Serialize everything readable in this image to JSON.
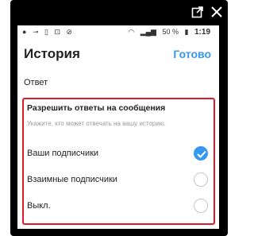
{
  "status_bar": {
    "battery_percent": "50 %",
    "time": "1:19"
  },
  "header": {
    "title": "История",
    "done_label": "Готово"
  },
  "reply_section": {
    "label": "Ответ"
  },
  "message_replies": {
    "title": "Разрешить ответы на сообщения",
    "hint": "Укажите, кто может отвечать на вашу историю.",
    "options": [
      {
        "label": "Ваши подписчики",
        "selected": true
      },
      {
        "label": "Взаимные подписчики",
        "selected": false
      },
      {
        "label": "Выкл.",
        "selected": false
      }
    ]
  },
  "colors": {
    "accent": "#3897f0",
    "highlight_border": "#e01a2b"
  },
  "icons": [
    "external-link-icon",
    "close-icon",
    "checkmark-icon"
  ]
}
